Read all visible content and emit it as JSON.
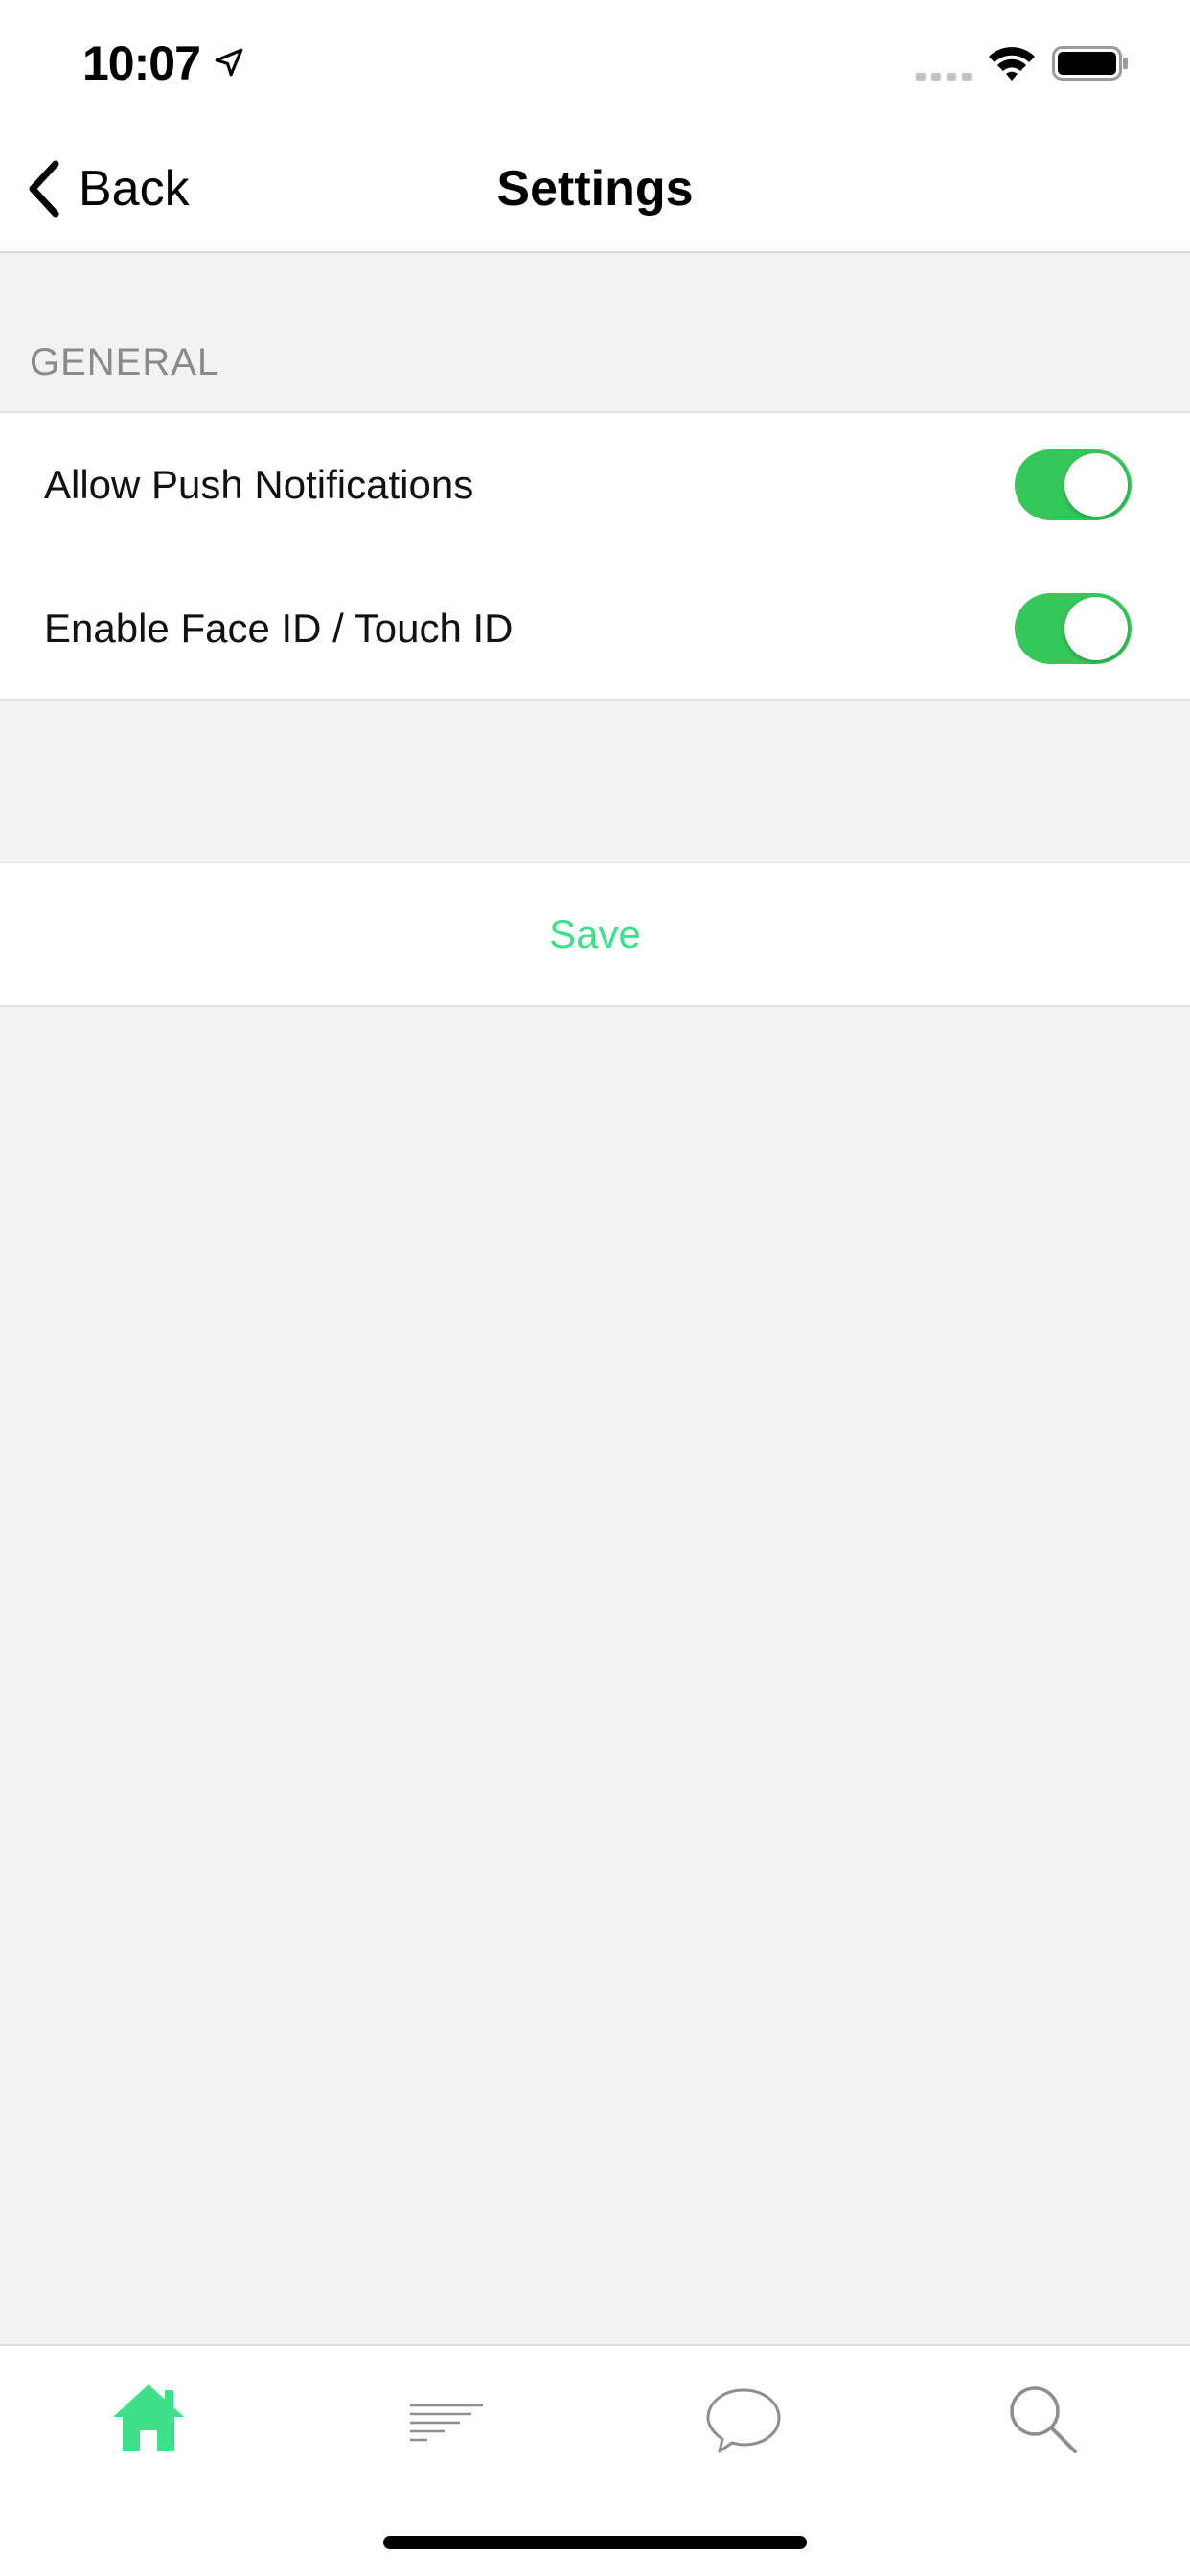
{
  "status_bar": {
    "time": "10:07",
    "icons": [
      "location-arrow-icon",
      "cellular-signal-icon",
      "wifi-icon",
      "battery-icon"
    ]
  },
  "nav": {
    "back_label": "Back",
    "title": "Settings"
  },
  "section": {
    "header": "GENERAL"
  },
  "settings": [
    {
      "label": "Allow Push Notifications",
      "enabled": true
    },
    {
      "label": "Enable Face ID / Touch ID",
      "enabled": true
    }
  ],
  "save": {
    "label": "Save"
  },
  "tab_bar": {
    "tabs": [
      {
        "icon": "home-icon",
        "active": true
      },
      {
        "icon": "feed-list-icon",
        "active": false
      },
      {
        "icon": "chat-bubble-icon",
        "active": false
      },
      {
        "icon": "search-icon",
        "active": false
      }
    ]
  },
  "colors": {
    "accent": "#3ee08a",
    "toggle_on": "#35c759",
    "background": "#f2f2f2",
    "section_header": "#8a8a8a",
    "inactive_icon": "#8e8e8e"
  }
}
